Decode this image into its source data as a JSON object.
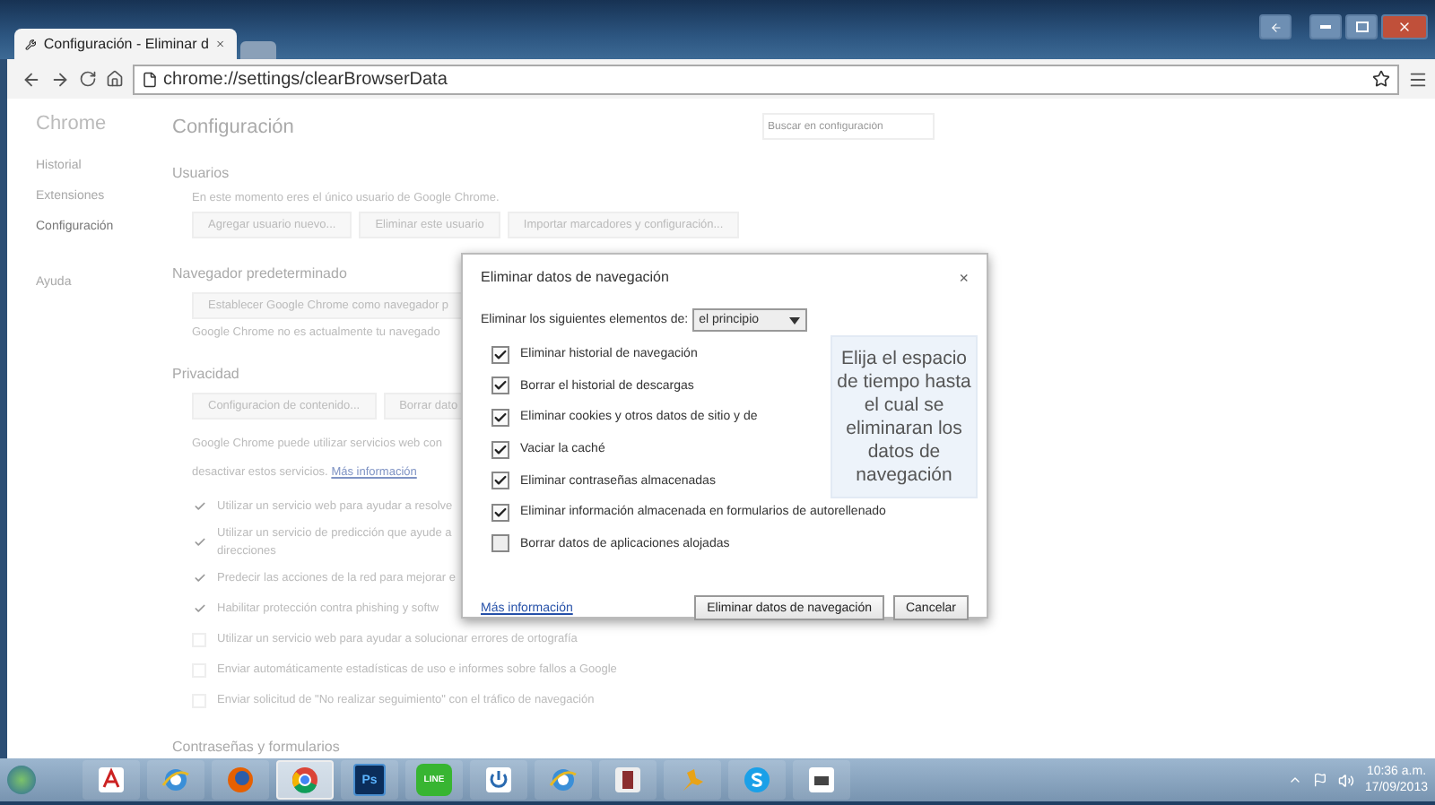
{
  "window": {
    "tab_title": "Configuración - Eliminar d",
    "url": "chrome://settings/clearBrowserData"
  },
  "sidebar": {
    "title": "Chrome",
    "items": [
      {
        "label": "Historial",
        "selected": false
      },
      {
        "label": "Extensiones",
        "selected": false
      },
      {
        "label": "Configuración",
        "selected": true
      },
      {
        "label": "Ayuda",
        "selected": false
      }
    ]
  },
  "settings": {
    "title": "Configuración",
    "search_placeholder": "Buscar en configuración",
    "blocks": [
      {
        "kind": "heading",
        "text": "Usuarios"
      },
      {
        "kind": "note",
        "text": "En este momento eres el único usuario de Google Chrome."
      },
      {
        "kind": "buttons",
        "buttons": [
          "Agregar usuario nuevo...",
          "Eliminar este usuario",
          "Importar marcadores y configuración..."
        ]
      },
      {
        "kind": "heading",
        "text": "Navegador predeterminado"
      },
      {
        "kind": "buttons",
        "buttons": [
          "Establecer Google Chrome como navegador p"
        ]
      },
      {
        "kind": "note",
        "text": "Google Chrome no es actualmente tu navegado"
      },
      {
        "kind": "heading",
        "text": "Privacidad"
      },
      {
        "kind": "buttons",
        "buttons": [
          "Configuracion de contenido...",
          "Borrar dato"
        ]
      },
      {
        "kind": "paragraph",
        "lines": [
          "Google Chrome puede utilizar servicios web con",
          "desactivar estos servicios."
        ],
        "link": "Más información"
      },
      {
        "kind": "check",
        "checked": true,
        "lines": [
          "Utilizar un servicio web para ayudar a resolve"
        ]
      },
      {
        "kind": "check",
        "checked": true,
        "lines": [
          "Utilizar un servicio de predicción que ayude a",
          "direcciones"
        ]
      },
      {
        "kind": "check",
        "checked": true,
        "lines": [
          "Predecir las acciones de la red para mejorar e"
        ]
      },
      {
        "kind": "check",
        "checked": true,
        "lines": [
          "Habilitar protección contra phishing y softw"
        ]
      },
      {
        "kind": "check",
        "checked": false,
        "lines": [
          "Utilizar un servicio web para ayudar a solucionar errores de ortografía"
        ]
      },
      {
        "kind": "check",
        "checked": false,
        "lines": [
          "Enviar automáticamente estadísticas de uso e informes sobre fallos a Google"
        ]
      },
      {
        "kind": "check",
        "checked": false,
        "lines": [
          "Enviar solicitud de \"No realizar seguimiento\" con el tráfico de navegación"
        ]
      },
      {
        "kind": "heading",
        "text": "Contraseñas y formularios"
      }
    ]
  },
  "dialog": {
    "title": "Eliminar datos de navegación",
    "close": "×",
    "range_label": "Eliminar los siguientes elementos de:",
    "range_value": "el principio",
    "items": [
      {
        "label": "Eliminar historial de navegación",
        "checked": true
      },
      {
        "label": "Borrar el historial de descargas",
        "checked": true
      },
      {
        "label": "Eliminar cookies y otros datos de sitio y de",
        "checked": true
      },
      {
        "label": "Vaciar la caché",
        "checked": true
      },
      {
        "label": "Eliminar contraseñas almacenadas",
        "checked": true
      },
      {
        "label": "Eliminar información almacenada en formularios de autorellenado",
        "checked": true
      },
      {
        "label": "Borrar datos de aplicaciones alojadas",
        "checked": false
      }
    ],
    "link": "Más información",
    "buttons": [
      "Eliminar datos de navegación",
      "Cancelar"
    ]
  },
  "callout": {
    "text": "Elija el espacio de tiempo hasta el cual se eliminaran los datos de navegación"
  },
  "taskbar": {
    "apps": [
      {
        "kind": "pdf",
        "selected": false
      },
      {
        "kind": "ie",
        "selected": false
      },
      {
        "kind": "firefox",
        "selected": false
      },
      {
        "kind": "chrome",
        "selected": true
      },
      {
        "kind": "ps",
        "selected": false,
        "label": "Ps"
      },
      {
        "kind": "line",
        "selected": false,
        "label": "LINE"
      },
      {
        "kind": "power",
        "selected": false
      },
      {
        "kind": "ie",
        "selected": false
      },
      {
        "kind": "book",
        "selected": false
      },
      {
        "kind": "gecko",
        "selected": false
      },
      {
        "kind": "skype",
        "selected": false
      },
      {
        "kind": "doc",
        "selected": false
      }
    ],
    "time": "10:36 a.m.",
    "date": "17/09/2013"
  }
}
